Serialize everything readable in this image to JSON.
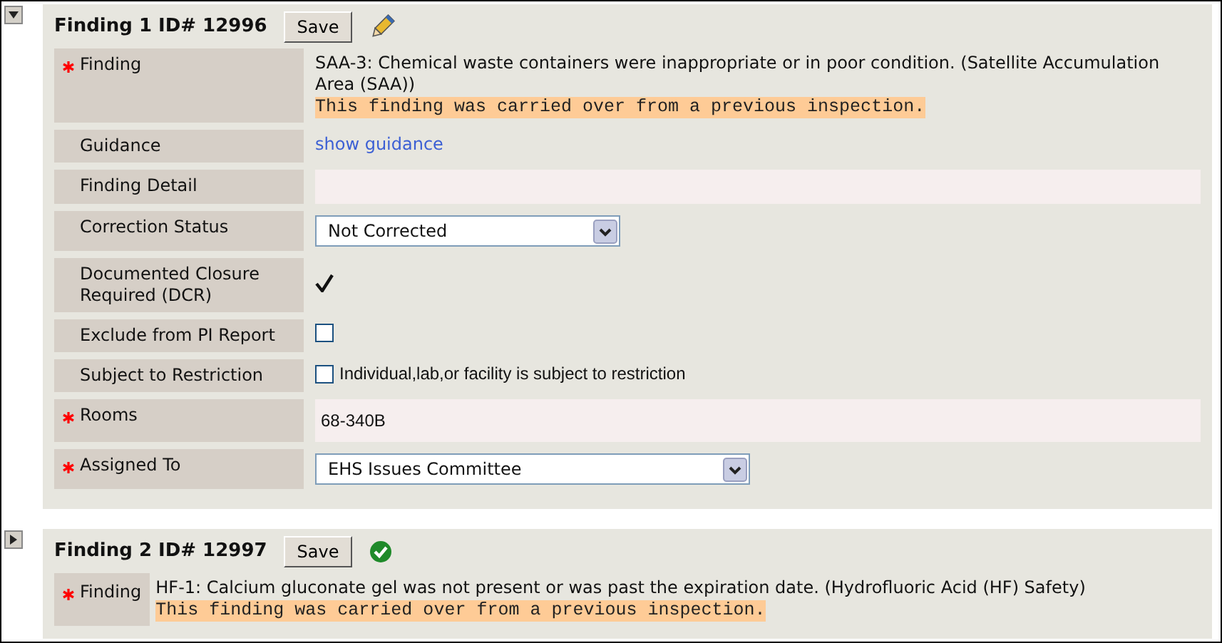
{
  "findings": [
    {
      "expanded": true,
      "title": "Finding 1 ID# 12996",
      "save_label": "Save",
      "completed": false,
      "fields": [
        {
          "kind": "text",
          "label": "Finding",
          "required": true,
          "value": "SAA-3: Chemical waste containers were inappropriate or in poor condition. (Satellite Accumulation Area (SAA))",
          "note": "This finding was carried over from a previous inspection."
        },
        {
          "kind": "link",
          "label": "Guidance",
          "required": false,
          "value": "show guidance"
        },
        {
          "kind": "textarea",
          "label": "Finding Detail",
          "required": false
        },
        {
          "kind": "select",
          "label": "Correction Status",
          "required": false,
          "value": "Not Corrected"
        },
        {
          "kind": "tick",
          "label": "Documented Closure Required (DCR)",
          "required": false,
          "checked": true
        },
        {
          "kind": "checkbox",
          "label": "Exclude from PI Report",
          "required": false,
          "checked": false
        },
        {
          "kind": "checkbox",
          "label": "Subject to Restriction",
          "required": false,
          "checked": false,
          "option": "Individual,lab,or facility is subject to restriction"
        },
        {
          "kind": "textarea",
          "label": "Rooms",
          "required": true,
          "value": "68-340B"
        },
        {
          "kind": "wide-select",
          "label": "Assigned To",
          "required": true,
          "value": "EHS Issues Committee"
        }
      ]
    },
    {
      "expanded": false,
      "title": "Finding 2 ID# 12997",
      "save_label": "Save",
      "completed": true,
      "fields": [
        {
          "kind": "text",
          "label": "Finding",
          "required": true,
          "value": "HF-1: Calcium gluconate gel was not present or was past the expiration date. (Hydrofluoric Acid (HF) Safety)",
          "note": "This finding was carried over from a previous inspection."
        }
      ]
    }
  ]
}
